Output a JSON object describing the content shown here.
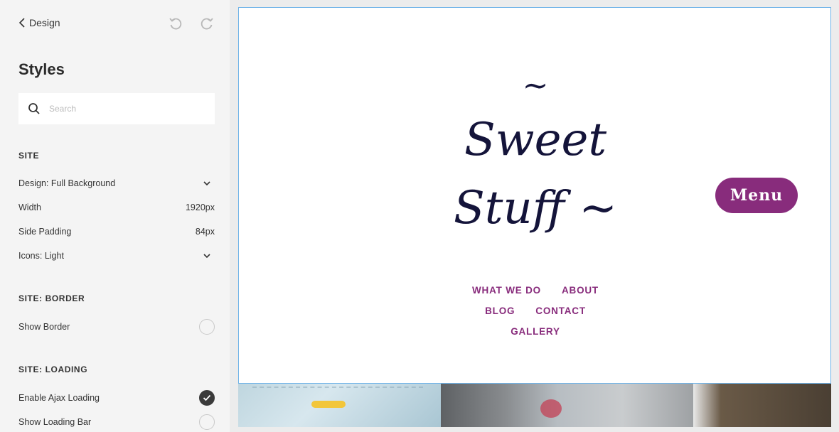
{
  "header": {
    "back_label": "Design"
  },
  "panel": {
    "title": "Styles",
    "search": {
      "placeholder": "Search",
      "value": ""
    },
    "sections": {
      "site": {
        "heading": "SITE",
        "design_label": "Design: Full Background",
        "width_label": "Width",
        "width_value": "1920px",
        "padding_label": "Side Padding",
        "padding_value": "84px",
        "icons_label": "Icons: Light"
      },
      "border": {
        "heading": "SITE: BORDER",
        "show_border_label": "Show Border",
        "show_border_on": false
      },
      "loading": {
        "heading": "SITE: LOADING",
        "ajax_label": "Enable Ajax Loading",
        "ajax_on": true,
        "bar_label": "Show Loading Bar",
        "bar_on": false
      }
    }
  },
  "preview": {
    "site_title": {
      "tilde_top": "~",
      "line1": "Sweet",
      "line2": "Stuff ~"
    },
    "menu_button": "Menu",
    "nav": [
      {
        "label": "WHAT WE DO"
      },
      {
        "label": "ABOUT"
      },
      {
        "label": "BLOG"
      },
      {
        "label": "CONTACT"
      },
      {
        "label": "GALLERY"
      }
    ]
  },
  "colors": {
    "accent": "#882c7c",
    "title": "#14143a",
    "selection_border": "#6fb3e8",
    "panel_bg": "#f4f4f4"
  },
  "icons": [
    "chevron-left-icon",
    "undo-icon",
    "redo-icon",
    "search-icon",
    "chevron-down-icon",
    "checkmark-icon"
  ]
}
